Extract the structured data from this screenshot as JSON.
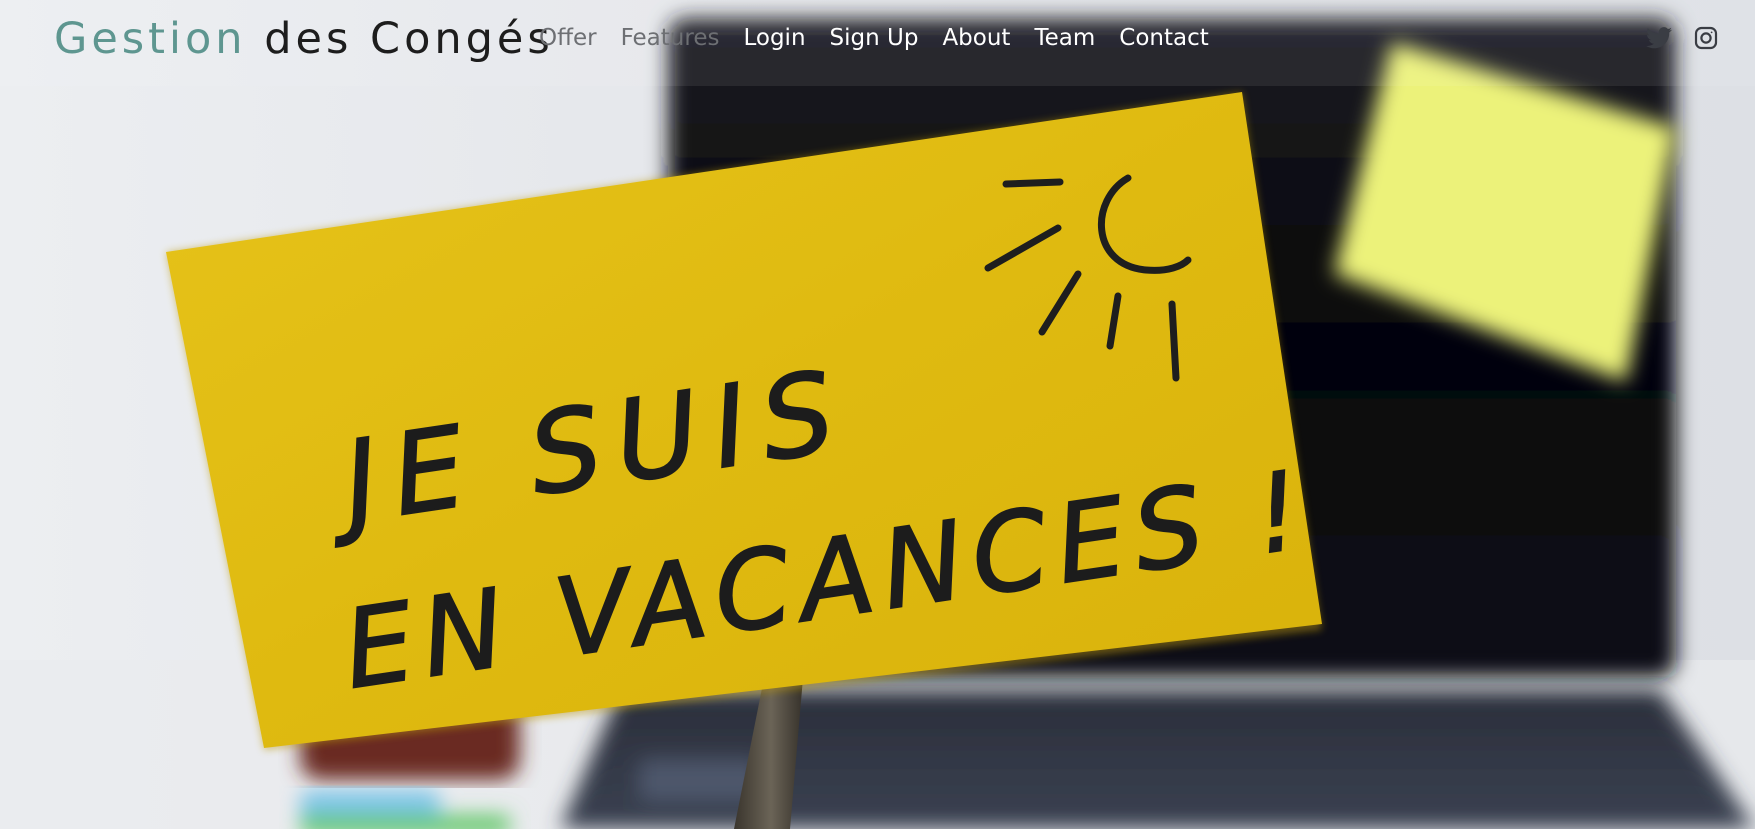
{
  "brand": {
    "part1": "Gestion",
    "part2": "des Congés"
  },
  "nav": {
    "offer": "Offer",
    "features": "Features",
    "login": "Login",
    "signup": "Sign Up",
    "about": "About",
    "team": "Team",
    "contact": "Contact"
  },
  "social": [
    "twitter-icon",
    "instagram-icon"
  ],
  "hero": {
    "sign_line1": "JE SUIS",
    "sign_line2": "EN VACANCES !"
  },
  "colors": {
    "brand_accent": "#5e9690",
    "brand_dark": "#1d1d1d",
    "sign_yellow": "#e2bf13",
    "sticky_note": "#ecf27a",
    "nav_light": "#ffffff",
    "nav_dim": "#6d6f73"
  }
}
